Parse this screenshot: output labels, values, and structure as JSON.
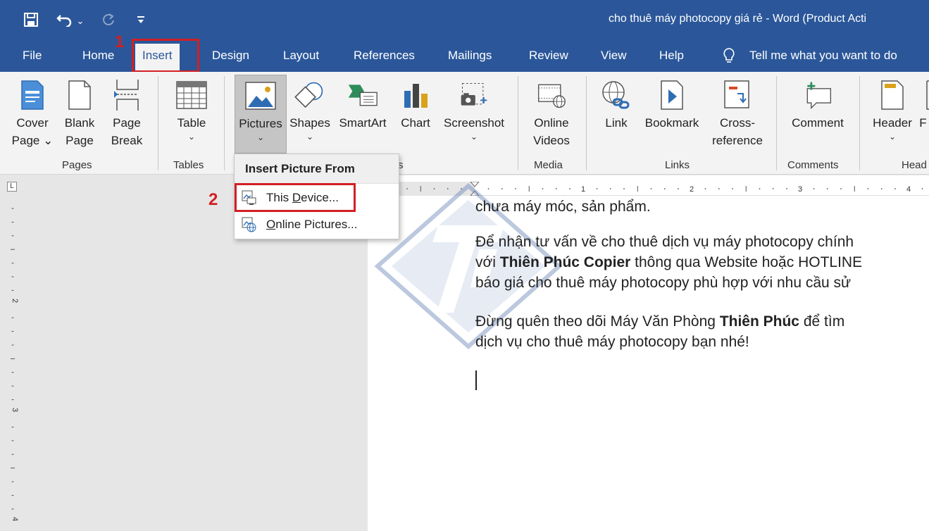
{
  "title_bar": {
    "doc_title": "cho thuê máy photocopy giá rẻ  -  Word (Product Acti",
    "save_glyph": "🖫",
    "undo_glyph": "↶",
    "undo_caret": "⌄",
    "redo_glyph": "↻",
    "customize_glyph": "⩡"
  },
  "tabs": {
    "file": "File",
    "home": "Home",
    "insert": "Insert",
    "design": "Design",
    "layout": "Layout",
    "references": "References",
    "mailings": "Mailings",
    "review": "Review",
    "view": "View",
    "help": "Help",
    "tell_me": "Tell me what you want to do"
  },
  "ribbon": {
    "cover_page": "Cover\nPage ⌄",
    "blank_page": "Blank\nPage",
    "page_break": "Page\nBreak",
    "table": "Table",
    "pictures": "Pictures",
    "shapes": "Shapes",
    "smartart": "SmartArt",
    "chart": "Chart",
    "screenshot": "Screenshot",
    "online_videos": "Online\nVideos",
    "link": "Link",
    "bookmark": "Bookmark",
    "cross_reference": "Cross-\nreference",
    "comment": "Comment",
    "header": "Header",
    "footer_partial": "F",
    "caret": "⌄",
    "groups": {
      "pages": "Pages",
      "tables": "Tables",
      "illustrations_partial": "s",
      "media": "Media",
      "links": "Links",
      "comments": "Comments",
      "header_partial": "Head"
    }
  },
  "dropdown": {
    "header": "Insert Picture From",
    "items": [
      {
        "label": "This Device...",
        "mnemonic": "D"
      },
      {
        "label": "Online Pictures...",
        "mnemonic": "O"
      }
    ]
  },
  "annotations": {
    "step1": "1",
    "step2": "2"
  },
  "ruler": {
    "corner": "L",
    "h_numbers": [
      "1",
      "2",
      "3",
      "4"
    ],
    "v_numbers": [
      "2",
      "3",
      "4"
    ]
  },
  "document": {
    "line1": "chưa máy móc, sản phẩm.",
    "para2": [
      {
        "parts": [
          {
            "t": "Để nhận tư vấn về cho thuê dịch vụ máy photocopy chính",
            "b": false
          }
        ]
      },
      {
        "parts": [
          {
            "t": "với ",
            "b": false
          },
          {
            "t": "Thiên Phúc Copier",
            "b": true
          },
          {
            "t": " thông qua Website hoặc HOTLINE",
            "b": false
          }
        ]
      },
      {
        "parts": [
          {
            "t": "báo giá cho thuê máy photocopy phù hợp với nhu cầu sử",
            "b": false
          }
        ]
      }
    ],
    "para3": [
      {
        "parts": [
          {
            "t": "Đừng quên theo dõi Máy Văn Phòng ",
            "b": false
          },
          {
            "t": "Thiên Phúc",
            "b": true
          },
          {
            "t": " để tìm",
            "b": false
          }
        ]
      },
      {
        "parts": [
          {
            "t": "dịch vụ cho thuê máy photocopy bạn nhé!",
            "b": false
          }
        ]
      }
    ]
  },
  "colors": {
    "word_blue": "#2b579a",
    "annotation_red": "#d31f24",
    "ribbon_bg": "#f3f3f3"
  }
}
